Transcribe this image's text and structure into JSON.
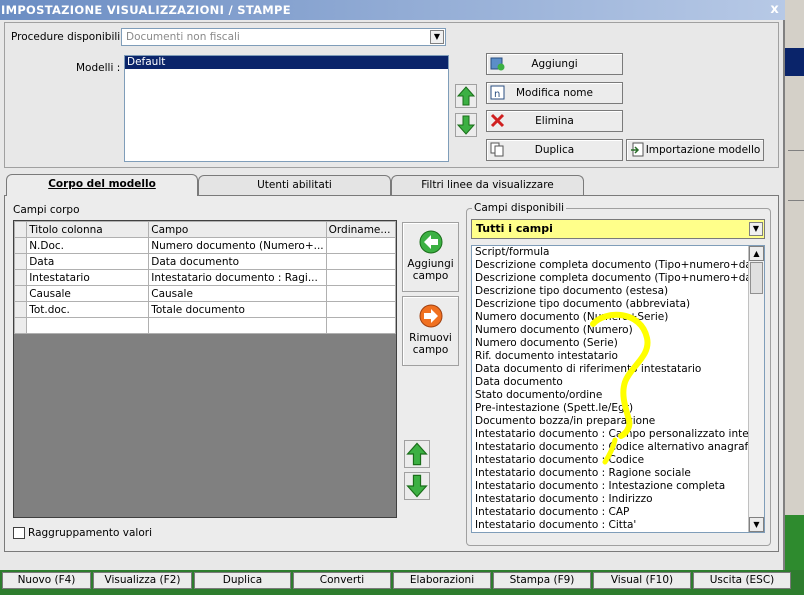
{
  "window": {
    "title": "IMPOSTAZIONE VISUALIZZAZIONI / STAMPE",
    "close_label": "x"
  },
  "top": {
    "procedure_label": "Procedure disponibili :",
    "procedure_value": "Documenti non fiscali",
    "modelli_label": "Modelli :",
    "modelli_items": [
      "Default"
    ],
    "buttons": {
      "aggiungi": "Aggiungi",
      "modifica": "Modifica nome",
      "elimina": "Elimina",
      "duplica": "Duplica",
      "importazione": "Importazione modello"
    }
  },
  "tabs": [
    "Corpo del modello",
    "Utenti abilitati",
    "Filtri linee da visualizzare"
  ],
  "corpo": {
    "label": "Campi corpo",
    "columns": [
      "Titolo colonna",
      "Campo",
      "Ordiname..."
    ],
    "rows": [
      [
        "N.Doc.",
        "Numero documento (Numero+...",
        ""
      ],
      [
        "Data",
        "Data documento",
        ""
      ],
      [
        "Intestatario",
        "Intestatario documento : Ragi...",
        ""
      ],
      [
        "Causale",
        "Causale",
        ""
      ],
      [
        "Tot.doc.",
        "Totale documento",
        ""
      ],
      [
        "",
        "",
        ""
      ]
    ],
    "aggiungi_campo": [
      "Aggiungi",
      "campo"
    ],
    "rimuovi_campo": [
      "Rimuovi",
      "campo"
    ],
    "raggruppamento": "Raggruppamento valori"
  },
  "campi_disponibili": {
    "label": "Campi disponibili",
    "filter_value": "Tutti i campi",
    "items": [
      "Script/formula",
      "Descrizione completa documento (Tipo+numero+data) (e",
      "Descrizione completa documento (Tipo+numero+data) (a",
      "Descrizione tipo documento (estesa)",
      "Descrizione tipo documento (abbreviata)",
      "Numero documento (Numero+Serie)",
      "Numero documento (Numero)",
      "Numero documento (Serie)",
      "Rif. documento intestatario",
      "Data documento di riferimento intestatario",
      "Data documento",
      "Stato documento/ordine",
      "Pre-intestazione (Spett.le/Egr)",
      "Documento bozza/in preparazione",
      "Intestatario documento : Campo personalizzato intestata",
      "Intestatario documento : Codice alternativo anagrafica",
      "Intestatario documento : Codice",
      "Intestatario documento : Ragione sociale",
      "Intestatario documento : Intestazione completa",
      "Intestatario documento : Indirizzo",
      "Intestatario documento : CAP",
      "Intestatario documento : Citta'"
    ]
  },
  "footer": [
    "Nuovo (F4)",
    "Visualizza (F2)",
    "Duplica",
    "Converti",
    "Elaborazioni",
    "Stampa (F9)",
    "Visual (F10)",
    "Uscita (ESC)"
  ],
  "colors": {
    "title_bar": "#6b8dc3",
    "selection": "#0a246a",
    "filter_bg": "#ffff8a",
    "footer_bg": "#2e7d2e",
    "annotation": "#ffff00"
  }
}
